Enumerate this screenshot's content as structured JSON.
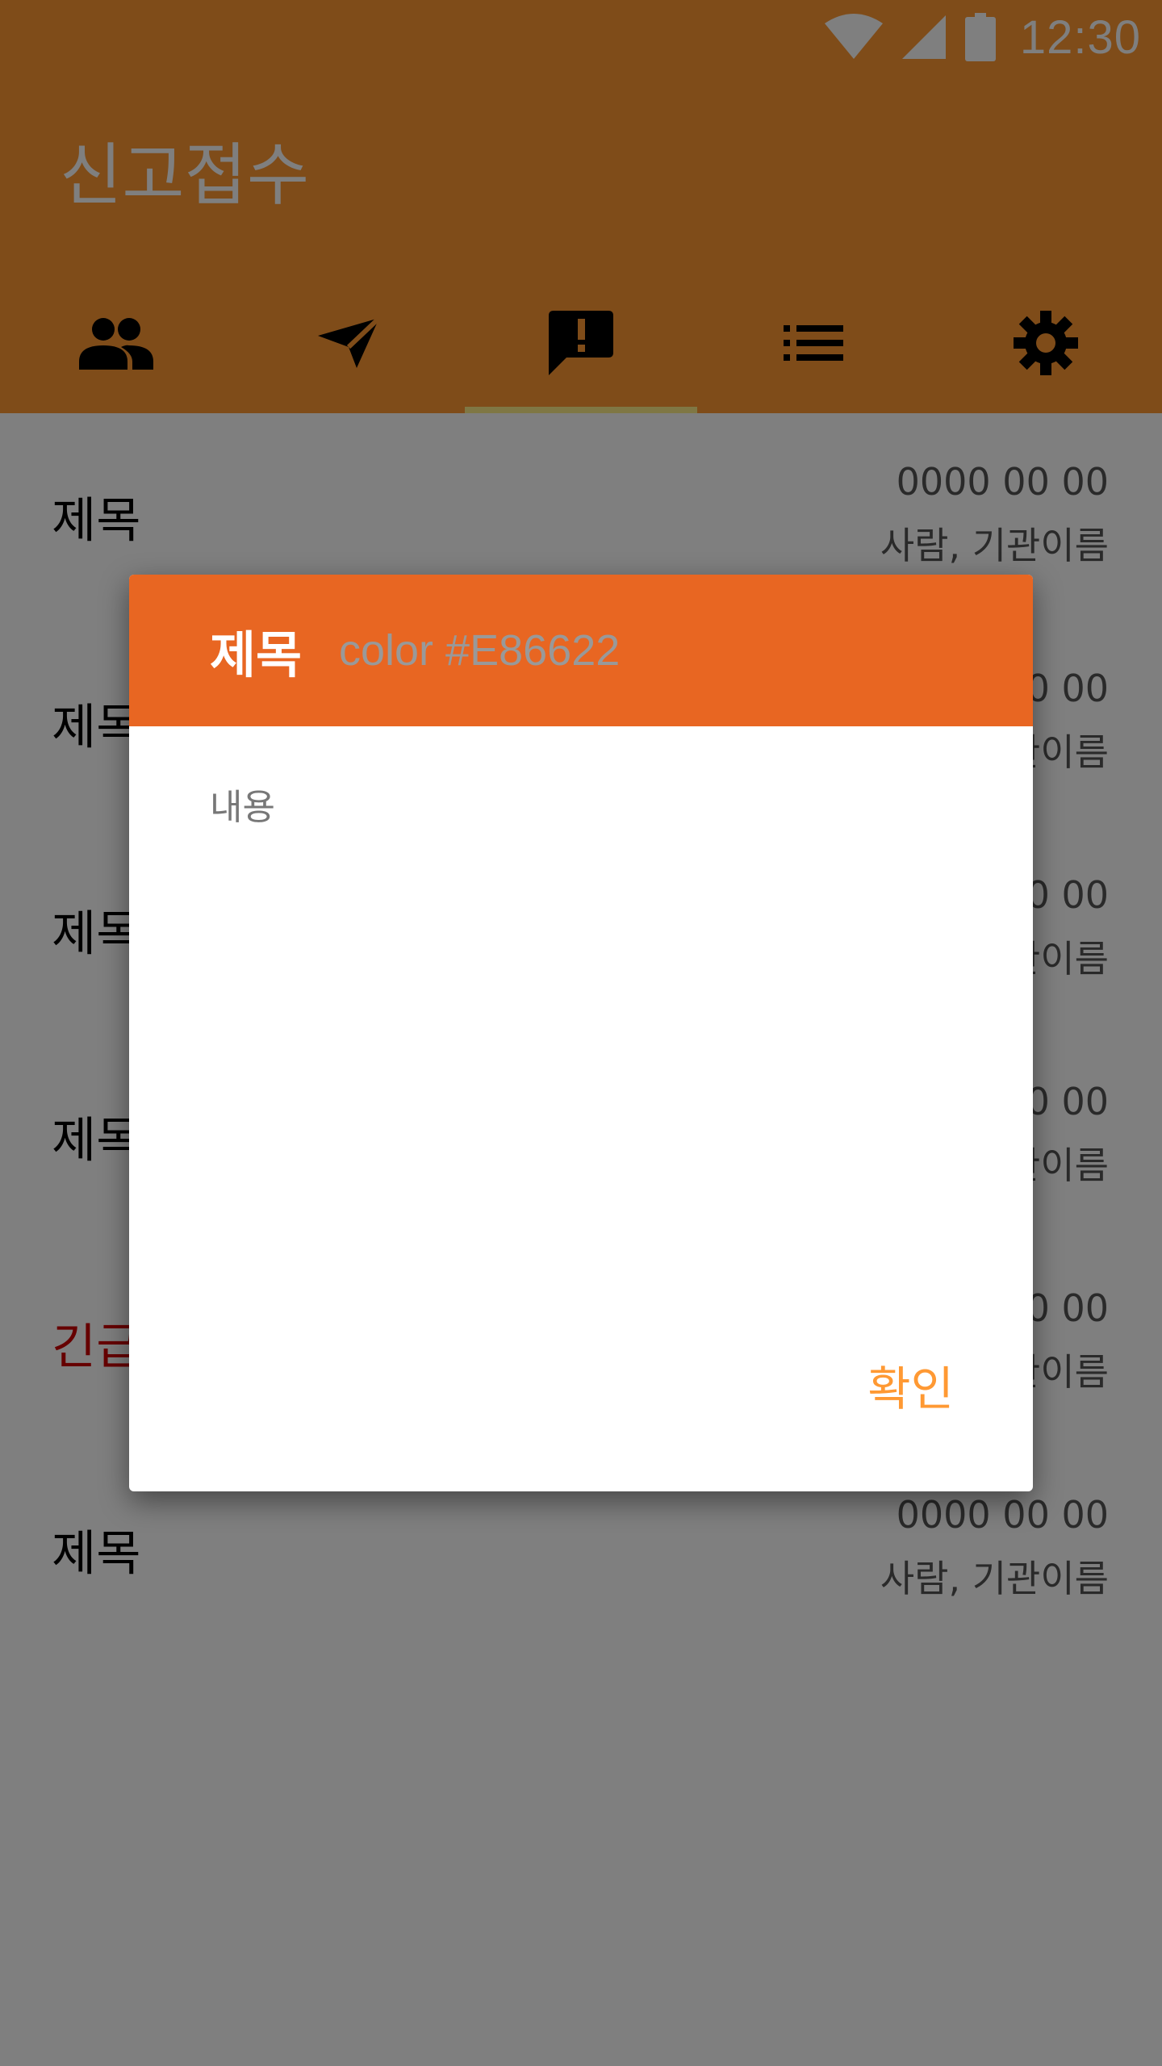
{
  "status_bar": {
    "time": "12:30",
    "icons": [
      "wifi-icon",
      "cellular-signal-icon",
      "battery-icon"
    ]
  },
  "app": {
    "title": "신고접수"
  },
  "tabs": [
    {
      "icon": "people-icon",
      "selected": false
    },
    {
      "icon": "send-icon",
      "selected": false
    },
    {
      "icon": "report-message-icon",
      "selected": true
    },
    {
      "icon": "list-icon",
      "selected": false
    },
    {
      "icon": "settings-gear-icon",
      "selected": false
    }
  ],
  "list": {
    "items": [
      {
        "title": "제목",
        "date": "0000 00 00",
        "org": "사람, 기관이름",
        "urgent": false
      },
      {
        "title": "제목",
        "date": "0000 00 00",
        "org": "사람, 기관이름",
        "urgent": false
      },
      {
        "title": "제목",
        "date": "0000 00 00",
        "org": "사람, 기관이름",
        "urgent": false
      },
      {
        "title": "제목",
        "date": "0000 00 00",
        "org": "사람, 기관이름",
        "urgent": false
      },
      {
        "title": "긴급",
        "date": "0000 00 00",
        "org": "사람, 기관이름",
        "urgent": true
      },
      {
        "title": "제목",
        "date": "0000 00 00",
        "org": "사람, 기관이름",
        "urgent": false
      }
    ]
  },
  "dialog": {
    "title": "제목",
    "subtitle": "color #E86622",
    "body": "내용",
    "confirm_label": "확인"
  },
  "colors": {
    "primary": "#FF9933",
    "dialog_header": "#E86622",
    "tab_indicator": "#FFEE88",
    "urgent": "#CC0000",
    "scrim": "rgba(0,0,0,0.5)"
  }
}
